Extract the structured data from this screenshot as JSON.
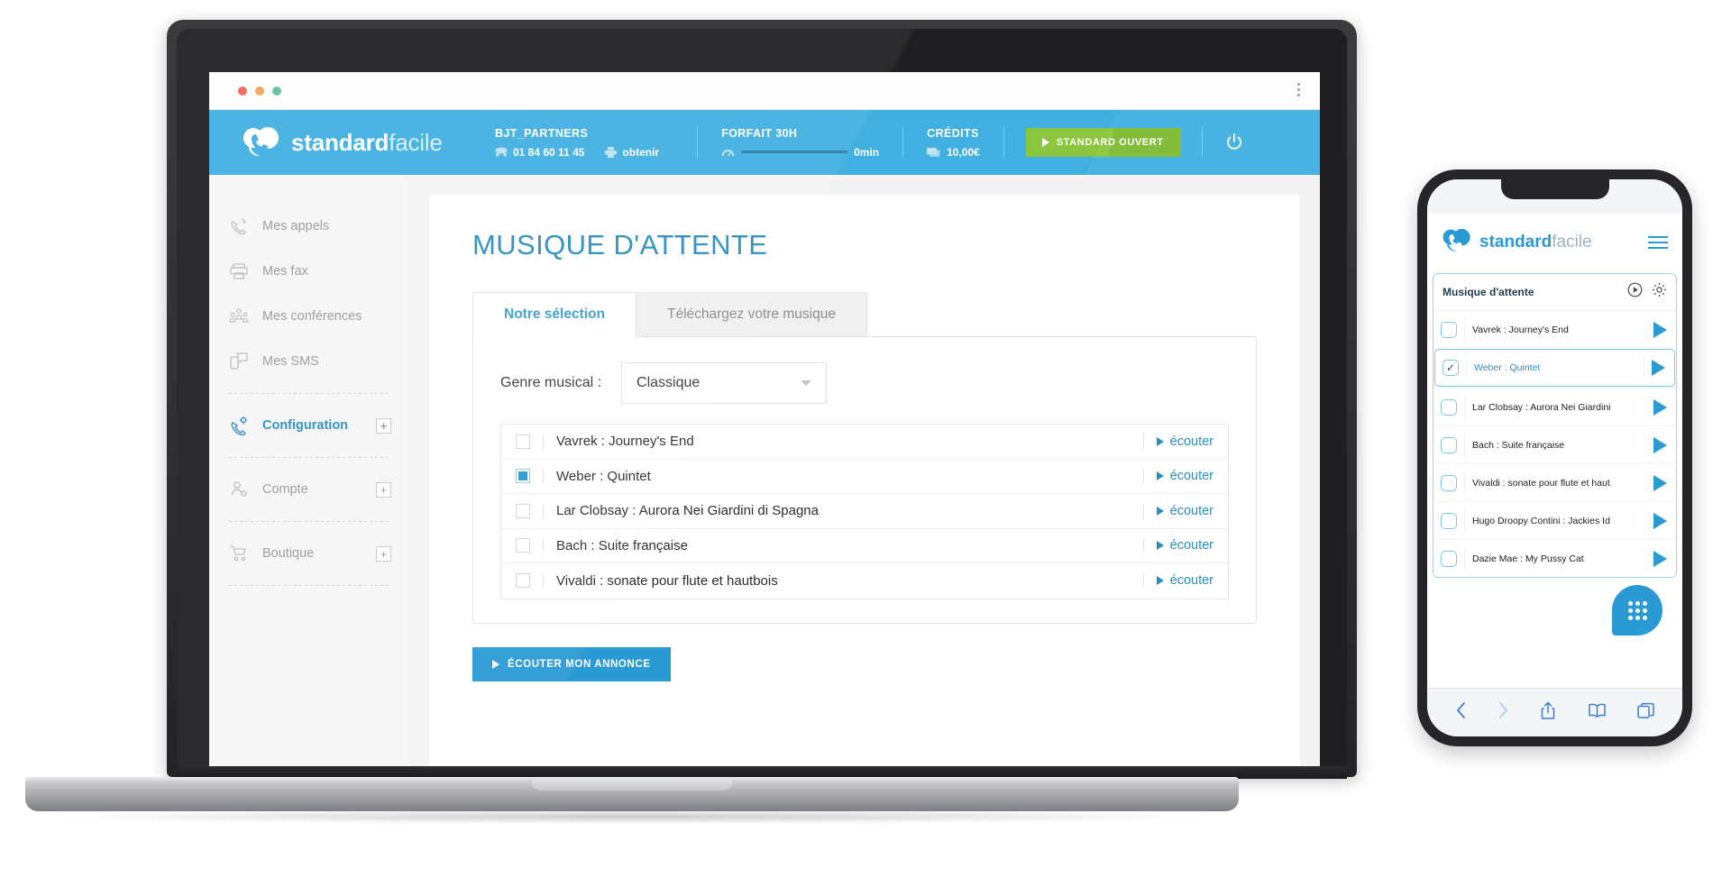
{
  "browser": {
    "dots": [
      "close",
      "minimize",
      "maximize"
    ],
    "menu_icon": "kebab-menu-icon"
  },
  "app_header": {
    "brand": {
      "bold": "standard",
      "light": "facile",
      "logo_icon": "standardfacile-logo"
    },
    "account": {
      "title": "BJT_PARTNERS",
      "phone_icon": "phone-icon",
      "phone": "01 84 60 11 45",
      "obtain_icon": "fax-icon",
      "obtain_label": "obtenir"
    },
    "plan": {
      "title": "FORFAIT 30H",
      "gauge_icon": "gauge-icon",
      "usage": "0min"
    },
    "credits": {
      "title": "CRÉDITS",
      "credit_icon": "credit-card-icon",
      "amount": "10,00€"
    },
    "status_button": {
      "label": "STANDARD OUVERT",
      "icon": "play-icon",
      "color": "#8cc63f"
    },
    "power_icon": "power-icon"
  },
  "sidebar": {
    "items": [
      {
        "label": "Mes appels",
        "icon": "phone-calls-icon",
        "active": false,
        "plus": false
      },
      {
        "label": "Mes fax",
        "icon": "fax-printer-icon",
        "active": false,
        "plus": false
      },
      {
        "label": "Mes conférences",
        "icon": "conference-icon",
        "active": false,
        "plus": false
      },
      {
        "label": "Mes SMS",
        "icon": "sms-icon",
        "active": false,
        "plus": false
      },
      {
        "label": "Configuration",
        "icon": "settings-phone-icon",
        "active": true,
        "plus": true
      },
      {
        "label": "Compte",
        "icon": "user-settings-icon",
        "active": false,
        "plus": true
      },
      {
        "label": "Boutique",
        "icon": "shopping-cart-icon",
        "active": false,
        "plus": true
      }
    ],
    "plus_label": "+"
  },
  "main": {
    "page_title": "MUSIQUE D'ATTENTE",
    "tabs": [
      {
        "label": "Notre sélection",
        "active": true
      },
      {
        "label": "Téléchargez votre musique",
        "active": false
      }
    ],
    "genre": {
      "label": "Genre musical :",
      "value": "Classique",
      "caret_icon": "chevron-down-icon"
    },
    "tracks": [
      {
        "name": "Vavrek : Journey's End",
        "checked": false,
        "listen": "écouter"
      },
      {
        "name": "Weber : Quintet",
        "checked": true,
        "listen": "écouter"
      },
      {
        "name": "Lar Clobsay : Aurora Nei Giardini di Spagna",
        "checked": false,
        "listen": "écouter"
      },
      {
        "name": "Bach : Suite française",
        "checked": false,
        "listen": "écouter"
      },
      {
        "name": "Vivaldi : sonate pour flute et hautbois",
        "checked": false,
        "listen": "écouter"
      }
    ],
    "announce_button": {
      "label": "ÉCOUTER MON ANNONCE",
      "icon": "play-icon"
    }
  },
  "phone": {
    "brand": {
      "bold": "standard",
      "light": "facile",
      "logo_icon": "standardfacile-logo"
    },
    "menu_icon": "hamburger-menu-icon",
    "card": {
      "title": "Musique d'attente",
      "play_icon": "play-circle-icon",
      "settings_icon": "gear-icon"
    },
    "rows": [
      {
        "name": "Vavrek : Journey's End",
        "checked": false,
        "selected": false
      },
      {
        "name": "Weber : Quintet",
        "checked": true,
        "selected": true
      },
      {
        "name": "Lar Clobsay : Aurora Nei Giardini",
        "checked": false,
        "selected": false
      },
      {
        "name": "Bach : Suite française",
        "checked": false,
        "selected": false
      },
      {
        "name": "Vivaldi : sonate pour flute et haut",
        "checked": false,
        "selected": false
      },
      {
        "name": "Hugo Droopy Contini : Jackies Id",
        "checked": false,
        "selected": false
      },
      {
        "name": "Dazie Mae : My Pussy Cat",
        "checked": false,
        "selected": false
      }
    ],
    "check_glyph": "✓",
    "fab_icon": "keypad-icon",
    "bottom_bar": [
      {
        "icon": "back-icon",
        "dim": false
      },
      {
        "icon": "forward-icon",
        "dim": true
      },
      {
        "icon": "share-icon",
        "dim": false
      },
      {
        "icon": "bookmarks-icon",
        "dim": false
      },
      {
        "icon": "tabs-icon",
        "dim": false
      }
    ]
  },
  "colors": {
    "brand_blue": "#2a9ad4",
    "header_blue": "#41b0e0",
    "green": "#8cc63f",
    "title_blue": "#2a8fc0"
  }
}
